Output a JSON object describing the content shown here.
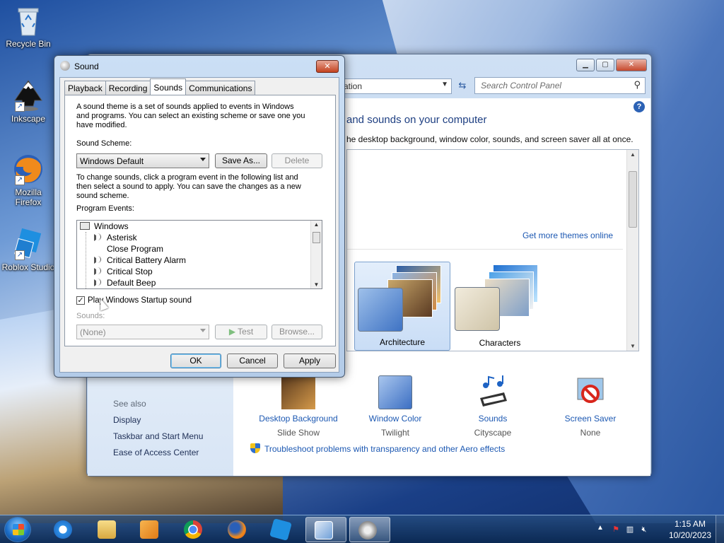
{
  "desktop": {
    "icons": [
      {
        "label": "Recycle Bin"
      },
      {
        "label": "Inkscape"
      },
      {
        "label": "Mozilla Firefox"
      },
      {
        "label": "Roblox Studio"
      }
    ]
  },
  "control_panel": {
    "address_text": "ation",
    "search_placeholder": "Search Control Panel",
    "heading": "and sounds on your computer",
    "description": "he desktop background, window color, sounds, and screen saver all at once.",
    "get_more_themes": "Get more themes online",
    "themes": [
      {
        "label": "Architecture",
        "selected": true
      },
      {
        "label": "Characters",
        "selected": false
      }
    ],
    "tiles": [
      {
        "title": "Desktop Background",
        "value": "Slide Show",
        "icon": "desktop-background-icon"
      },
      {
        "title": "Window Color",
        "value": "Twilight",
        "icon": "window-color-icon"
      },
      {
        "title": "Sounds",
        "value": "Cityscape",
        "icon": "sounds-icon"
      },
      {
        "title": "Screen Saver",
        "value": "None",
        "icon": "screen-saver-icon"
      }
    ],
    "see_also": {
      "heading": "See also",
      "links": [
        "Display",
        "Taskbar and Start Menu",
        "Ease of Access Center"
      ]
    },
    "troubleshoot_link": "Troubleshoot problems with transparency and other Aero effects"
  },
  "sound_dialog": {
    "title": "Sound",
    "close_label": "✕",
    "tabs": [
      {
        "label": "Playback"
      },
      {
        "label": "Recording"
      },
      {
        "label": "Sounds",
        "active": true
      },
      {
        "label": "Communications"
      }
    ],
    "intro_line1": "A sound theme is a set of sounds applied to events in Windows",
    "intro_line2": "and programs.  You can select an existing scheme or save one you",
    "intro_line3": "have modified.",
    "scheme_label": "Sound Scheme:",
    "scheme_value": "Windows Default",
    "save_as_label": "Save As...",
    "delete_label": "Delete",
    "change_line1": "To change sounds, click a program event in the following list and",
    "change_line2": "then select a sound to apply.  You can save the changes as a new",
    "change_line3": "sound scheme.",
    "events_label": "Program Events:",
    "events_root": "Windows",
    "events": [
      "Asterisk",
      "Close Program",
      "Critical Battery Alarm",
      "Critical Stop",
      "Default Beep"
    ],
    "events_with_sound": [
      true,
      false,
      true,
      true,
      true
    ],
    "startup_checkbox_label": "Play Windows Startup sound",
    "startup_checked": true,
    "sounds_label": "Sounds:",
    "sound_value": "(None)",
    "test_label": "Test",
    "browse_label": "Browse...",
    "ok_label": "OK",
    "cancel_label": "Cancel",
    "apply_label": "Apply"
  },
  "taskbar": {
    "apps": [
      {
        "name": "internet-explorer",
        "active": false
      },
      {
        "name": "file-explorer",
        "active": false
      },
      {
        "name": "media-player",
        "active": false
      },
      {
        "name": "chrome",
        "active": false
      },
      {
        "name": "firefox",
        "active": false
      },
      {
        "name": "roblox-studio",
        "active": false
      },
      {
        "name": "control-panel",
        "active": true
      },
      {
        "name": "sound",
        "active": true
      }
    ],
    "clock_time": "1:15 AM",
    "clock_date": "10/20/2023"
  }
}
